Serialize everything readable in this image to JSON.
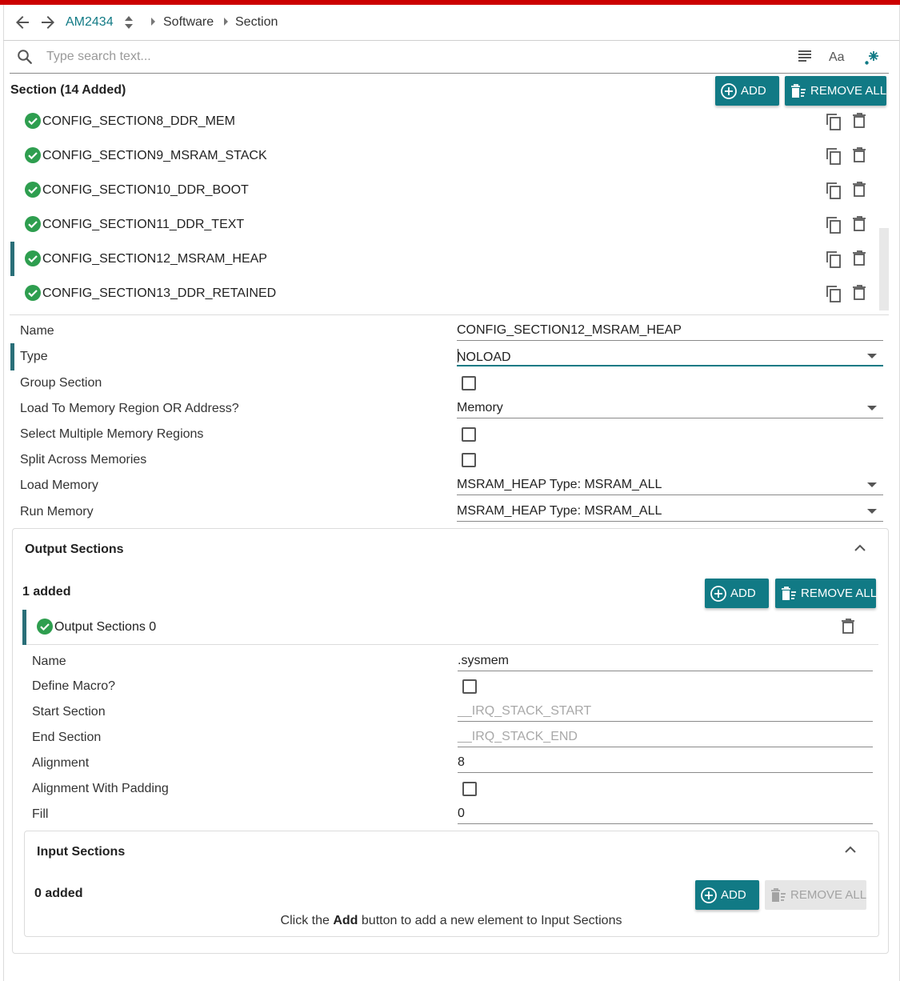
{
  "colors": {
    "accent": "#117a85",
    "brand_bar": "#cc0000",
    "success": "#2e9e4f",
    "selection": "#2a6f78"
  },
  "nav": {
    "back_icon": "arrow-left-icon",
    "forward_icon": "arrow-right-icon",
    "device": "AM2434",
    "crumbs": [
      "Software",
      "Section"
    ]
  },
  "search": {
    "placeholder": "Type search text...",
    "icons": [
      "search-icon",
      "list-view-icon",
      "font-size-icon",
      "sparkle-icon"
    ],
    "font_label": "Aa"
  },
  "section": {
    "title": "Section (14 Added)",
    "add_label": "ADD",
    "remove_all_label": "REMOVE ALL",
    "items": [
      {
        "label": "CONFIG_SECTION8_DDR_MEM"
      },
      {
        "label": "CONFIG_SECTION9_MSRAM_STACK"
      },
      {
        "label": "CONFIG_SECTION10_DDR_BOOT"
      },
      {
        "label": "CONFIG_SECTION11_DDR_TEXT"
      },
      {
        "label": "CONFIG_SECTION12_MSRAM_HEAP",
        "selected": true
      },
      {
        "label": "CONFIG_SECTION13_DDR_RETAINED"
      }
    ]
  },
  "form": {
    "name_label": "Name",
    "name_value": "CONFIG_SECTION12_MSRAM_HEAP",
    "type_label": "Type",
    "type_value": "NOLOAD",
    "group_label": "Group Section",
    "group_checked": false,
    "load_to_label": "Load To Memory Region OR Address?",
    "load_to_value": "Memory",
    "multi_label": "Select Multiple Memory Regions",
    "multi_checked": false,
    "split_label": "Split Across Memories",
    "split_checked": false,
    "load_mem_label": "Load Memory",
    "load_mem_value": "MSRAM_HEAP Type: MSRAM_ALL",
    "run_mem_label": "Run Memory",
    "run_mem_value": "MSRAM_HEAP Type: MSRAM_ALL"
  },
  "output_sections": {
    "title": "Output Sections",
    "count": "1 added",
    "add_label": "ADD",
    "remove_all_label": "REMOVE ALL",
    "item_label": "Output Sections 0",
    "fields": {
      "name_label": "Name",
      "name_value": ".sysmem",
      "macro_label": "Define Macro?",
      "macro_checked": false,
      "start_label": "Start Section",
      "start_value": "__IRQ_STACK_START",
      "end_label": "End Section",
      "end_value": "__IRQ_STACK_END",
      "align_label": "Alignment",
      "align_value": "8",
      "align_pad_label": "Alignment With Padding",
      "align_pad_checked": false,
      "fill_label": "Fill",
      "fill_value": "0"
    }
  },
  "input_sections": {
    "title": "Input Sections",
    "count": "0 added",
    "add_label": "ADD",
    "remove_all_label": "REMOVE ALL",
    "hint_pre": "Click the",
    "hint_bold": "Add",
    "hint_post": "button to add a new element to Input Sections"
  }
}
